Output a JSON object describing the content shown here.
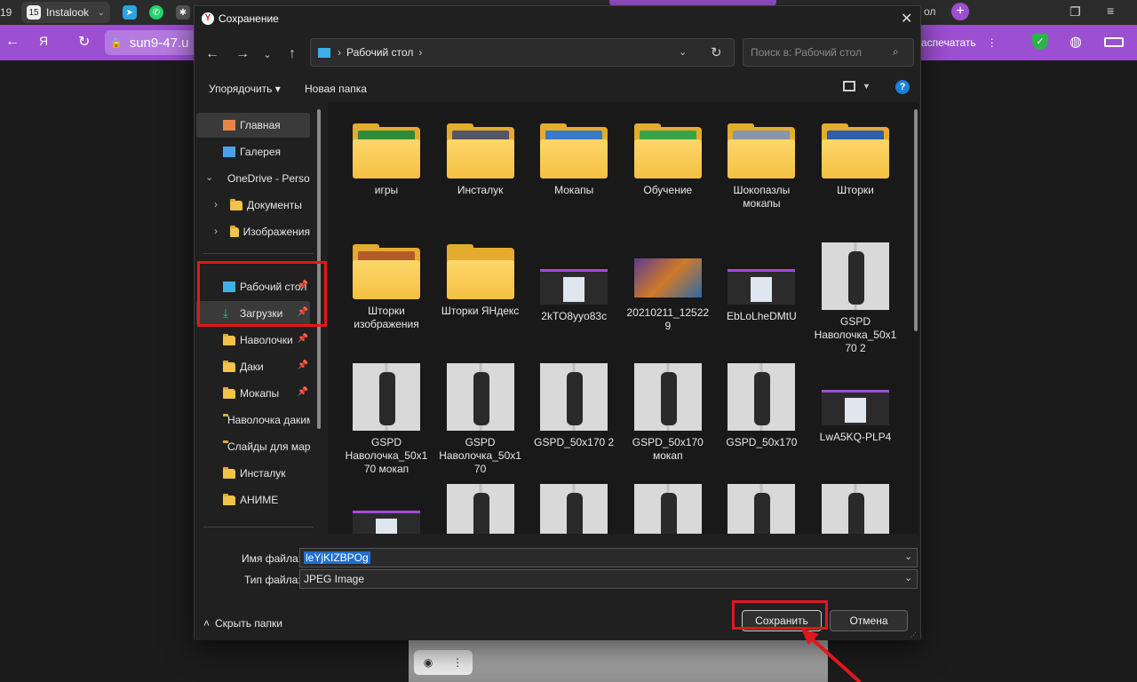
{
  "browser": {
    "tab_counter": "19",
    "tab_badge": "15",
    "tab_title": "Instalook",
    "address_text": "sun9-47.u",
    "side_tab_fragment": "ол",
    "print_label": "аспечатать"
  },
  "dialog": {
    "title": "Сохранение",
    "breadcrumb_sep": "›",
    "path": "Рабочий стол",
    "search_placeholder": "Поиск в: Рабочий стол",
    "toolbar": {
      "organize": "Упорядочить",
      "new_folder": "Новая папка"
    },
    "nav": [
      {
        "label": "Главная",
        "icon": "home-icon"
      },
      {
        "label": "Галерея",
        "icon": "gallery-icon"
      },
      {
        "label": "OneDrive - Personal",
        "icon": "cloud-icon"
      },
      {
        "label": "Документы",
        "icon": "folder-icon"
      },
      {
        "label": "Изображения",
        "icon": "folder-icon"
      },
      {
        "label": "Рабочий стол",
        "icon": "desktop-icon"
      },
      {
        "label": "Загрузки",
        "icon": "download-icon"
      },
      {
        "label": "Наволочки",
        "icon": "folder-icon"
      },
      {
        "label": "Даки",
        "icon": "folder-icon"
      },
      {
        "label": "Мокапы",
        "icon": "folder-icon"
      },
      {
        "label": "Наволочка дакимакура",
        "icon": "folder-icon"
      },
      {
        "label": "Слайды для маркетплейса",
        "icon": "folder-icon"
      },
      {
        "label": "Инсталук",
        "icon": "folder-icon"
      },
      {
        "label": "АНИМЕ",
        "icon": "folder-icon"
      }
    ],
    "items": [
      {
        "label": "игры",
        "kind": "folder"
      },
      {
        "label": "Инсталук",
        "kind": "folder"
      },
      {
        "label": "Мокапы",
        "kind": "folder"
      },
      {
        "label": "Обучение",
        "kind": "folder"
      },
      {
        "label": "Шокопазлы мокапы",
        "kind": "folder"
      },
      {
        "label": "Шторки",
        "kind": "folder"
      },
      {
        "label": "Шторки изображения",
        "kind": "folder"
      },
      {
        "label": "Шторки ЯНдекс",
        "kind": "folder"
      },
      {
        "label": "2kTO8yyo83c",
        "kind": "screenshot"
      },
      {
        "label": "20210211_125229",
        "kind": "game"
      },
      {
        "label": "EbLoLheDMtU",
        "kind": "screenshot"
      },
      {
        "label": "GSPD Наволочка_50x170 2",
        "kind": "photo"
      },
      {
        "label": "GSPD Наволочка_50x170 мокап",
        "kind": "photo"
      },
      {
        "label": "GSPD Наволочка_50x170",
        "kind": "photo"
      },
      {
        "label": "GSPD_50x170 2",
        "kind": "photo"
      },
      {
        "label": "GSPD_50x170 мокап",
        "kind": "photo"
      },
      {
        "label": "GSPD_50x170",
        "kind": "photo"
      },
      {
        "label": "LwA5KQ-PLP4",
        "kind": "screenshot"
      },
      {
        "label": "",
        "kind": "screenshot"
      },
      {
        "label": "",
        "kind": "photo"
      },
      {
        "label": "",
        "kind": "photo"
      },
      {
        "label": "",
        "kind": "photo"
      },
      {
        "label": "",
        "kind": "photo"
      },
      {
        "label": "",
        "kind": "photo"
      }
    ],
    "filename_label": "Имя файла:",
    "filename_value": "leYjKIZBPOg",
    "filetype_label": "Тип файла:",
    "filetype_value": "JPEG Image",
    "hide_folders": "Скрыть папки",
    "save_button": "Сохранить",
    "cancel_button": "Отмена",
    "help_glyph": "?"
  },
  "colors": {
    "highlight_box": "#e0171d",
    "accent_purple": "#9c4fd0"
  }
}
